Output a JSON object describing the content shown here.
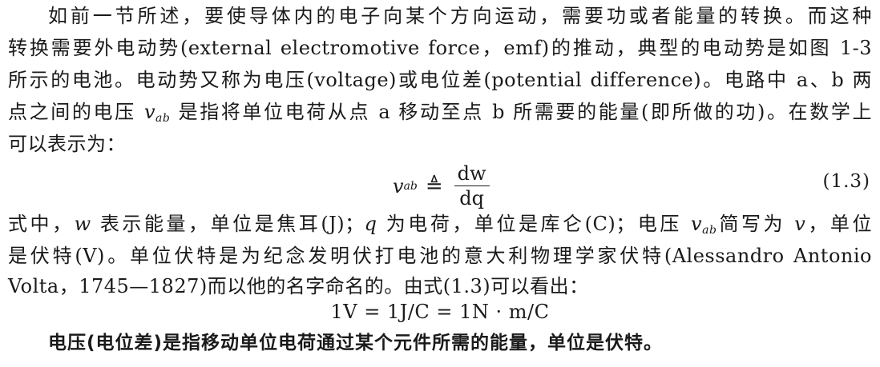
{
  "paragraph1": {
    "line1": "如前一节所述，要使导体内的电子向某个方向运动，需要功或者能量的转换。而这种",
    "line2": "转换需要外电动势(external electromotive force，emf)的推动，典型的电动势是如图 1-3",
    "line3": "所示的电池。电动势又称为电压(voltage)或电位差(potential difference)。电路中 a、b 两",
    "line4_pre": "点之间的电压 ",
    "line4_v": "v",
    "line4_sub": "ab",
    "line4_post": " 是指将单位电荷从点 a 移动至点 b 所需要的能量(即所做的功)。在数学上",
    "line5": "可以表示为："
  },
  "equation_1_3": {
    "lhs_var": "v",
    "lhs_sub": "ab",
    "operator": "≜",
    "numerator": "dw",
    "denominator": "dq",
    "number": "(1.3)"
  },
  "paragraph2": {
    "line1_a": "式中，",
    "line1_w": "w",
    "line1_b": " 表示能量，单位是焦耳(J)；",
    "line1_q": "q",
    "line1_c": " 为电荷，单位是库仑(C)；电压 ",
    "line1_v": "v",
    "line1_sub": "ab",
    "line1_d": "简写为 ",
    "line1_v2": "v",
    "line1_e": "，单位",
    "line2": "是伏特(V)。单位伏特是为纪念发明伏打电池的意大利物理学家伏特(Alessandro Antonio",
    "line3": "Volta，1745—1827)而以他的名字命名的。由式(1.3)可以看出："
  },
  "unit_equation": "1V = 1J/C = 1N · m/C",
  "conclusion": "电压(电位差)是指移动单位电荷通过某个元件所需的能量，单位是伏特。"
}
